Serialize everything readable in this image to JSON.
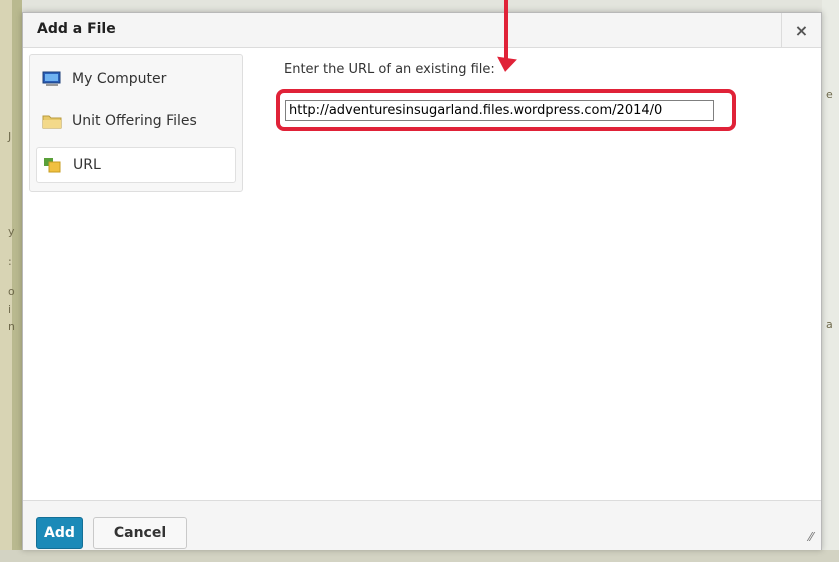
{
  "dialog": {
    "title": "Add a File",
    "close_label": "×"
  },
  "sources": [
    {
      "label": "My Computer",
      "icon": "computer-icon"
    },
    {
      "label": "Unit Offering Files",
      "icon": "folder-icon"
    },
    {
      "label": "URL",
      "icon": "url-icon",
      "selected": true
    }
  ],
  "url": {
    "label": "Enter the URL of an existing file:",
    "value": "http://adventuresinsugarland.files.wordpress.com/2014/0"
  },
  "footer": {
    "add_label": "Add",
    "cancel_label": "Cancel",
    "resize_glyph": "//"
  },
  "annotation": {
    "color": "#e02238"
  },
  "backdrop": {
    "left_fragments": [
      "J",
      "y",
      ":",
      "o",
      "i",
      "n"
    ],
    "right_fragments": [
      "e",
      "a"
    ]
  }
}
